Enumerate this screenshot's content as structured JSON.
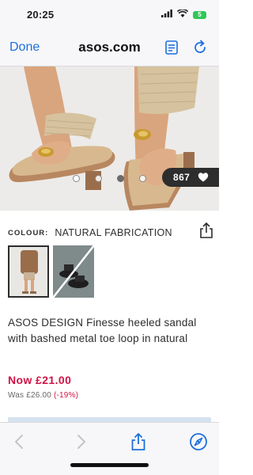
{
  "status_bar": {
    "time": "20:25",
    "battery": "5"
  },
  "browser": {
    "done_label": "Done",
    "domain": "asos.com"
  },
  "gallery": {
    "image_count": 4,
    "active_index": 2,
    "save_count": "867"
  },
  "product": {
    "colour_label": "COLOUR:",
    "colour_value": "NATURAL FABRICATION",
    "swatches": [
      "model-wearing",
      "sandal-black"
    ],
    "selected_swatch": 0,
    "title": "ASOS DESIGN Finesse heeled sandal with bashed metal toe loop in natural",
    "price_now": "Now £21.00",
    "price_was_label": "Was £26.00",
    "discount": "(-19%)"
  },
  "colors": {
    "accent": "#1e6fdc",
    "sale": "#d01345",
    "text": "#2d2d2d"
  },
  "icons": [
    "reader-icon",
    "reload-icon",
    "heart-icon",
    "share-icon",
    "back-icon",
    "forward-icon",
    "share-sheet-icon",
    "compass-icon"
  ]
}
